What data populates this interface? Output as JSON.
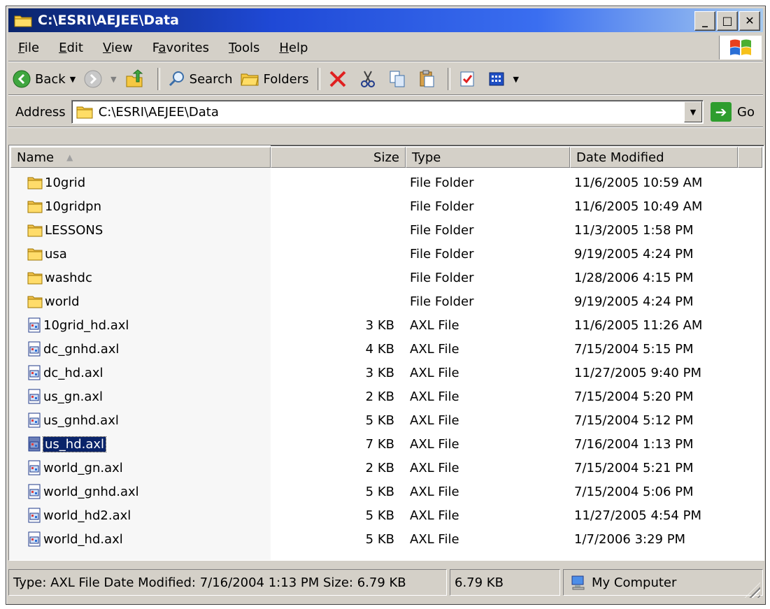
{
  "window": {
    "title": "C:\\ESRI\\AEJEE\\Data",
    "controls": {
      "minimize": "_",
      "maximize": "□",
      "close": "✕"
    }
  },
  "menu": {
    "items": [
      {
        "label": "File",
        "underline": "F"
      },
      {
        "label": "Edit",
        "underline": "E"
      },
      {
        "label": "View",
        "underline": "V"
      },
      {
        "label": "Favorites",
        "underline": "a"
      },
      {
        "label": "Tools",
        "underline": "T"
      },
      {
        "label": "Help",
        "underline": "H"
      }
    ]
  },
  "toolbar": {
    "back_label": "Back",
    "search_label": "Search",
    "folders_label": "Folders"
  },
  "address": {
    "label": "Address",
    "value": "C:\\ESRI\\AEJEE\\Data",
    "go_label": "Go"
  },
  "columns": {
    "name": "Name",
    "size": "Size",
    "type": "Type",
    "date": "Date Modified"
  },
  "files": [
    {
      "name": "10grid",
      "size": "",
      "type": "File Folder",
      "date": "11/6/2005 10:59 AM",
      "kind": "folder"
    },
    {
      "name": "10gridpn",
      "size": "",
      "type": "File Folder",
      "date": "11/6/2005 10:49 AM",
      "kind": "folder"
    },
    {
      "name": "LESSONS",
      "size": "",
      "type": "File Folder",
      "date": "11/3/2005 1:58 PM",
      "kind": "folder"
    },
    {
      "name": "usa",
      "size": "",
      "type": "File Folder",
      "date": "9/19/2005 4:24 PM",
      "kind": "folder"
    },
    {
      "name": "washdc",
      "size": "",
      "type": "File Folder",
      "date": "1/28/2006 4:15 PM",
      "kind": "folder"
    },
    {
      "name": "world",
      "size": "",
      "type": "File Folder",
      "date": "9/19/2005 4:24 PM",
      "kind": "folder"
    },
    {
      "name": "10grid_hd.axl",
      "size": "3 KB",
      "type": "AXL File",
      "date": "11/6/2005 11:26 AM",
      "kind": "file"
    },
    {
      "name": "dc_gnhd.axl",
      "size": "4 KB",
      "type": "AXL File",
      "date": "7/15/2004 5:15 PM",
      "kind": "file"
    },
    {
      "name": "dc_hd.axl",
      "size": "3 KB",
      "type": "AXL File",
      "date": "11/27/2005 9:40 PM",
      "kind": "file"
    },
    {
      "name": "us_gn.axl",
      "size": "2 KB",
      "type": "AXL File",
      "date": "7/15/2004 5:20 PM",
      "kind": "file"
    },
    {
      "name": "us_gnhd.axl",
      "size": "5 KB",
      "type": "AXL File",
      "date": "7/15/2004 5:12 PM",
      "kind": "file"
    },
    {
      "name": "us_hd.axl",
      "size": "7 KB",
      "type": "AXL File",
      "date": "7/16/2004 1:13 PM",
      "kind": "file",
      "selected": true
    },
    {
      "name": "world_gn.axl",
      "size": "2 KB",
      "type": "AXL File",
      "date": "7/15/2004 5:21 PM",
      "kind": "file"
    },
    {
      "name": "world_gnhd.axl",
      "size": "5 KB",
      "type": "AXL File",
      "date": "7/15/2004 5:06 PM",
      "kind": "file"
    },
    {
      "name": "world_hd2.axl",
      "size": "5 KB",
      "type": "AXL File",
      "date": "11/27/2005 4:54 PM",
      "kind": "file"
    },
    {
      "name": "world_hd.axl",
      "size": "5 KB",
      "type": "AXL File",
      "date": "1/7/2006 3:29 PM",
      "kind": "file"
    }
  ],
  "status": {
    "details": "Type: AXL File Date Modified: 7/16/2004 1:13 PM Size: 6.79 KB",
    "size": "6.79 KB",
    "zone": "My Computer"
  },
  "colors": {
    "title_gradient_start": "#0a246a",
    "title_gradient_end": "#a6caf0",
    "selection": "#0a246a",
    "chrome": "#d4d0c8"
  }
}
